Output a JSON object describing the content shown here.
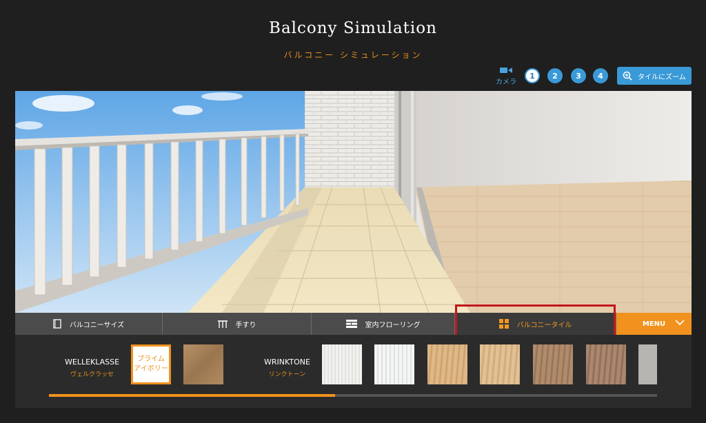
{
  "header": {
    "title": "Balcony Simulation",
    "subtitle": "バルコニー シミュレーション"
  },
  "camera": {
    "label": "カメラ",
    "icon": "video-camera-icon",
    "views": [
      "1",
      "2",
      "3",
      "4"
    ],
    "active_view": "1",
    "zoom_label": "タイルにズーム",
    "zoom_icon": "zoom-in-icon"
  },
  "tabs": [
    {
      "label": "バルコニーサイズ",
      "icon": "balcony-size-icon"
    },
    {
      "label": "手すり",
      "icon": "handrail-icon"
    },
    {
      "label": "室内フローリング",
      "icon": "flooring-icon"
    },
    {
      "label": "バルコニータイル",
      "icon": "tile-grid-icon",
      "active": true
    },
    {
      "label": "MENU",
      "icon": "chevron-down-icon"
    }
  ],
  "materials": {
    "series": [
      {
        "name": "WELLEKLASSE",
        "name_jp": "ヴェルクラッセ"
      },
      {
        "name": "WRINKTONE",
        "name_jp": "リンクトーン"
      }
    ],
    "selected_swatch": {
      "line1": "プライム",
      "line2": "アイボリー"
    },
    "scroll_progress": 0.47
  },
  "colors": {
    "accent": "#f0921d",
    "camera_blue": "#3a9ad8",
    "highlight_red": "#c2161c"
  }
}
